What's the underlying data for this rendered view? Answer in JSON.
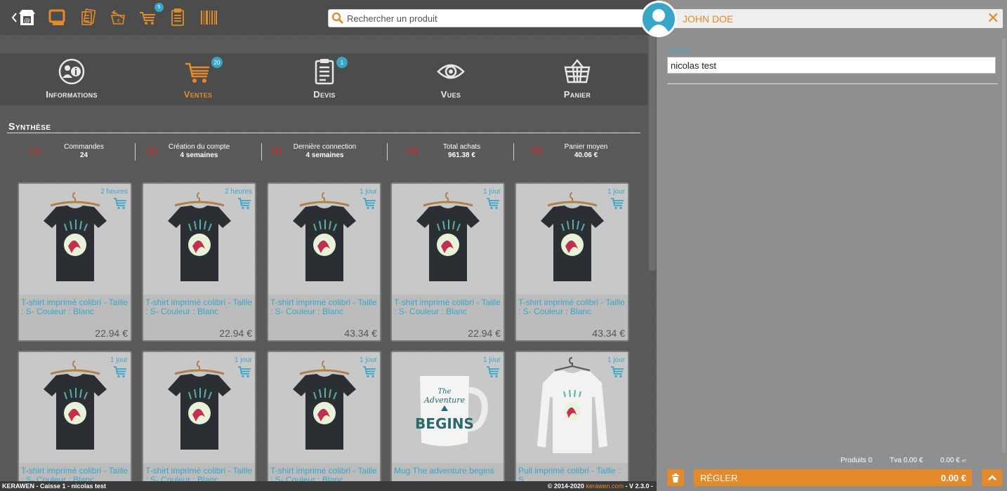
{
  "toolbar": {
    "search_placeholder": "Rechercher un produit",
    "cart_badge": "5",
    "icons": [
      "shop-icon",
      "screen-icon",
      "documents-icon",
      "return-icon",
      "cart-icon",
      "clipboard-icon",
      "barcode-icon"
    ]
  },
  "tabs": [
    {
      "label": "Informations",
      "icon": "info-user-icon",
      "badge": ""
    },
    {
      "label": "Ventes",
      "icon": "cart-icon",
      "badge": "20",
      "active": true
    },
    {
      "label": "Devis",
      "icon": "quote-icon",
      "badge": "1"
    },
    {
      "label": "Vues",
      "icon": "eye-icon",
      "badge": ""
    },
    {
      "label": "Panier",
      "icon": "basket-icon",
      "badge": ""
    }
  ],
  "synthese": {
    "title": "Synthèse",
    "stats": [
      {
        "num": "(1)",
        "label": "Commandes",
        "value": "24"
      },
      {
        "num": "(2)",
        "label": "Création du compte",
        "value": "4 semaines"
      },
      {
        "num": "(3)",
        "label": "Dernière connection",
        "value": "4 semaines"
      },
      {
        "num": "(4)",
        "label": "Total achats",
        "value": "961.38 €"
      },
      {
        "num": "(5)",
        "label": "Panier moyen",
        "value": "40.06 €"
      }
    ]
  },
  "products": [
    {
      "time": "2 heures",
      "title": "T-shirt imprimé colibri - Taille : S- Couleur : Blanc",
      "price": "22.94 €",
      "kind": "tshirt"
    },
    {
      "time": "2 heures",
      "title": "T-shirt imprimé colibri - Taille : S- Couleur : Blanc",
      "price": "22.94 €",
      "kind": "tshirt"
    },
    {
      "time": "1 jour",
      "title": "T-shirt imprimé colibri - Taille : S- Couleur : Blanc",
      "price": "43.34 €",
      "kind": "tshirt"
    },
    {
      "time": "1 jour",
      "title": "T-shirt imprimé colibri - Taille : S- Couleur : Blanc",
      "price": "22.94 €",
      "kind": "tshirt"
    },
    {
      "time": "1 jour",
      "title": "T-shirt imprimé colibri - Taille : S- Couleur : Blanc",
      "price": "43.34 €",
      "kind": "tshirt"
    },
    {
      "time": "1 jour",
      "title": "T-shirt imprimé colibri - Taille : S- Couleur : Blanc",
      "price": "",
      "kind": "tshirt"
    },
    {
      "time": "1 jour",
      "title": "T-shirt imprimé colibri - Taille : S- Couleur : Blanc",
      "price": "",
      "kind": "tshirt"
    },
    {
      "time": "1 jour",
      "title": "T-shirt imprimé colibri - Taille : S- Couleur : Blanc",
      "price": "",
      "kind": "tshirt"
    },
    {
      "time": "1 jour",
      "title": "Mug The adventure begins",
      "price": "",
      "kind": "mug"
    },
    {
      "time": "1 jour",
      "title": "Pull imprimé colibri - Taille : S",
      "price": "",
      "kind": "pull"
    }
  ],
  "footer": {
    "left": "KERAWEN - Caisse 1 - nicolas test",
    "copyright": "© 2014-2020 ",
    "link": "kerawen.com",
    "version": " - V 2.3.0 -"
  },
  "panel": {
    "client_name": "JOHN DOE",
    "cashier_label": "CAISSIER",
    "cashier_value": "nicolas test",
    "totals": {
      "produits": "Produits 0",
      "tva": "Tva 0.00 €",
      "total": "0.00 €",
      "total_suffix": "HT"
    },
    "pay_label": "RÉGLER",
    "pay_amount": "0.00 €"
  },
  "colors": {
    "accent": "#e58a2a",
    "info": "#38a6c9",
    "alert": "#e02020"
  }
}
